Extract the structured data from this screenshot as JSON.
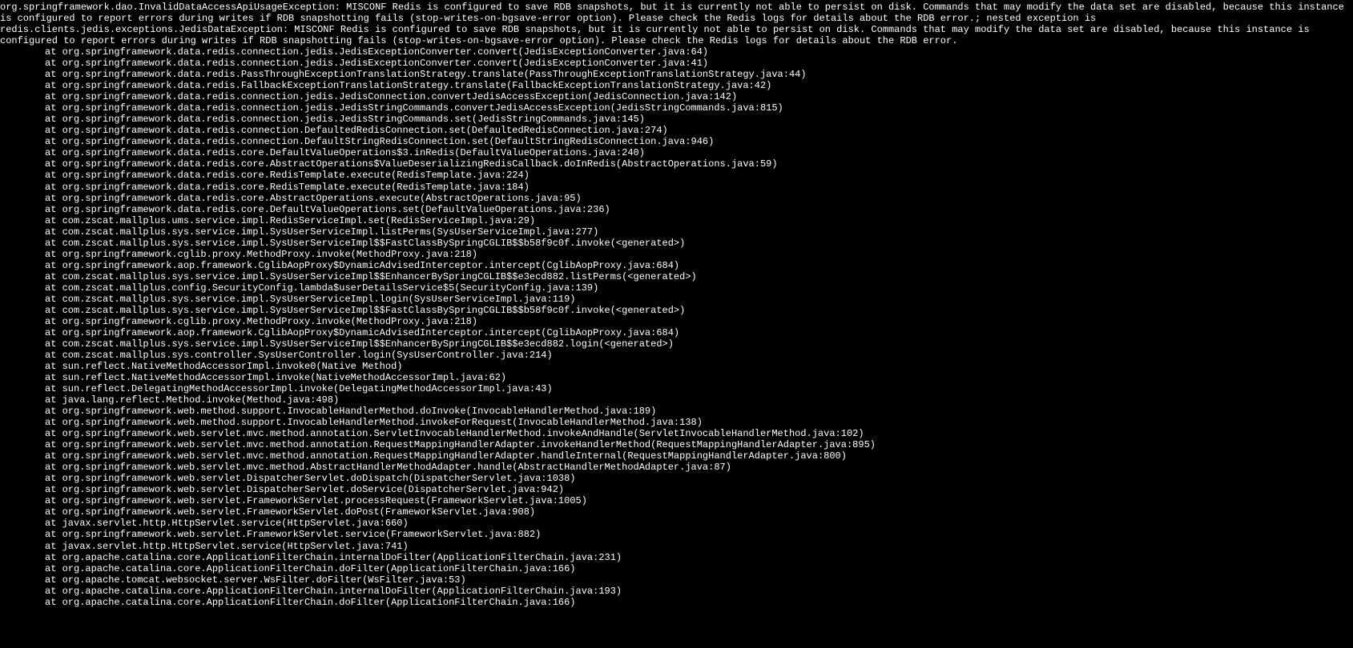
{
  "exception": {
    "header": "org.springframework.dao.InvalidDataAccessApiUsageException: MISCONF Redis is configured to save RDB snapshots, but it is currently not able to persist on disk. Commands that may modify the data set are disabled, because this instance is configured to report errors during writes if RDB snapshotting fails (stop-writes-on-bgsave-error option). Please check the Redis logs for details about the RDB error.; nested exception is redis.clients.jedis.exceptions.JedisDataException: MISCONF Redis is configured to save RDB snapshots, but it is currently not able to persist on disk. Commands that may modify the data set are disabled, because this instance is configured to report errors during writes if RDB snapshotting fails (stop-writes-on-bgsave-error option). Please check the Redis logs for details about the RDB error."
  },
  "stack": [
    "at org.springframework.data.redis.connection.jedis.JedisExceptionConverter.convert(JedisExceptionConverter.java:64)",
    "at org.springframework.data.redis.connection.jedis.JedisExceptionConverter.convert(JedisExceptionConverter.java:41)",
    "at org.springframework.data.redis.PassThroughExceptionTranslationStrategy.translate(PassThroughExceptionTranslationStrategy.java:44)",
    "at org.springframework.data.redis.FallbackExceptionTranslationStrategy.translate(FallbackExceptionTranslationStrategy.java:42)",
    "at org.springframework.data.redis.connection.jedis.JedisConnection.convertJedisAccessException(JedisConnection.java:142)",
    "at org.springframework.data.redis.connection.jedis.JedisStringCommands.convertJedisAccessException(JedisStringCommands.java:815)",
    "at org.springframework.data.redis.connection.jedis.JedisStringCommands.set(JedisStringCommands.java:145)",
    "at org.springframework.data.redis.connection.DefaultedRedisConnection.set(DefaultedRedisConnection.java:274)",
    "at org.springframework.data.redis.connection.DefaultStringRedisConnection.set(DefaultStringRedisConnection.java:946)",
    "at org.springframework.data.redis.core.DefaultValueOperations$3.inRedis(DefaultValueOperations.java:240)",
    "at org.springframework.data.redis.core.AbstractOperations$ValueDeserializingRedisCallback.doInRedis(AbstractOperations.java:59)",
    "at org.springframework.data.redis.core.RedisTemplate.execute(RedisTemplate.java:224)",
    "at org.springframework.data.redis.core.RedisTemplate.execute(RedisTemplate.java:184)",
    "at org.springframework.data.redis.core.AbstractOperations.execute(AbstractOperations.java:95)",
    "at org.springframework.data.redis.core.DefaultValueOperations.set(DefaultValueOperations.java:236)",
    "at com.zscat.mallplus.ums.service.impl.RedisServiceImpl.set(RedisServiceImpl.java:29)",
    "at com.zscat.mallplus.sys.service.impl.SysUserServiceImpl.listPerms(SysUserServiceImpl.java:277)",
    "at com.zscat.mallplus.sys.service.impl.SysUserServiceImpl$$FastClassBySpringCGLIB$$b58f9c0f.invoke(<generated>)",
    "at org.springframework.cglib.proxy.MethodProxy.invoke(MethodProxy.java:218)",
    "at org.springframework.aop.framework.CglibAopProxy$DynamicAdvisedInterceptor.intercept(CglibAopProxy.java:684)",
    "at com.zscat.mallplus.sys.service.impl.SysUserServiceImpl$$EnhancerBySpringCGLIB$$e3ecd882.listPerms(<generated>)",
    "at com.zscat.mallplus.config.SecurityConfig.lambda$userDetailsService$5(SecurityConfig.java:139)",
    "at com.zscat.mallplus.sys.service.impl.SysUserServiceImpl.login(SysUserServiceImpl.java:119)",
    "at com.zscat.mallplus.sys.service.impl.SysUserServiceImpl$$FastClassBySpringCGLIB$$b58f9c0f.invoke(<generated>)",
    "at org.springframework.cglib.proxy.MethodProxy.invoke(MethodProxy.java:218)",
    "at org.springframework.aop.framework.CglibAopProxy$DynamicAdvisedInterceptor.intercept(CglibAopProxy.java:684)",
    "at com.zscat.mallplus.sys.service.impl.SysUserServiceImpl$$EnhancerBySpringCGLIB$$e3ecd882.login(<generated>)",
    "at com.zscat.mallplus.sys.controller.SysUserController.login(SysUserController.java:214)",
    "at sun.reflect.NativeMethodAccessorImpl.invoke0(Native Method)",
    "at sun.reflect.NativeMethodAccessorImpl.invoke(NativeMethodAccessorImpl.java:62)",
    "at sun.reflect.DelegatingMethodAccessorImpl.invoke(DelegatingMethodAccessorImpl.java:43)",
    "at java.lang.reflect.Method.invoke(Method.java:498)",
    "at org.springframework.web.method.support.InvocableHandlerMethod.doInvoke(InvocableHandlerMethod.java:189)",
    "at org.springframework.web.method.support.InvocableHandlerMethod.invokeForRequest(InvocableHandlerMethod.java:138)",
    "at org.springframework.web.servlet.mvc.method.annotation.ServletInvocableHandlerMethod.invokeAndHandle(ServletInvocableHandlerMethod.java:102)",
    "at org.springframework.web.servlet.mvc.method.annotation.RequestMappingHandlerAdapter.invokeHandlerMethod(RequestMappingHandlerAdapter.java:895)",
    "at org.springframework.web.servlet.mvc.method.annotation.RequestMappingHandlerAdapter.handleInternal(RequestMappingHandlerAdapter.java:800)",
    "at org.springframework.web.servlet.mvc.method.AbstractHandlerMethodAdapter.handle(AbstractHandlerMethodAdapter.java:87)",
    "at org.springframework.web.servlet.DispatcherServlet.doDispatch(DispatcherServlet.java:1038)",
    "at org.springframework.web.servlet.DispatcherServlet.doService(DispatcherServlet.java:942)",
    "at org.springframework.web.servlet.FrameworkServlet.processRequest(FrameworkServlet.java:1005)",
    "at org.springframework.web.servlet.FrameworkServlet.doPost(FrameworkServlet.java:908)",
    "at javax.servlet.http.HttpServlet.service(HttpServlet.java:660)",
    "at org.springframework.web.servlet.FrameworkServlet.service(FrameworkServlet.java:882)",
    "at javax.servlet.http.HttpServlet.service(HttpServlet.java:741)",
    "at org.apache.catalina.core.ApplicationFilterChain.internalDoFilter(ApplicationFilterChain.java:231)",
    "at org.apache.catalina.core.ApplicationFilterChain.doFilter(ApplicationFilterChain.java:166)",
    "at org.apache.tomcat.websocket.server.WsFilter.doFilter(WsFilter.java:53)",
    "at org.apache.catalina.core.ApplicationFilterChain.internalDoFilter(ApplicationFilterChain.java:193)",
    "at org.apache.catalina.core.ApplicationFilterChain.doFilter(ApplicationFilterChain.java:166)"
  ]
}
